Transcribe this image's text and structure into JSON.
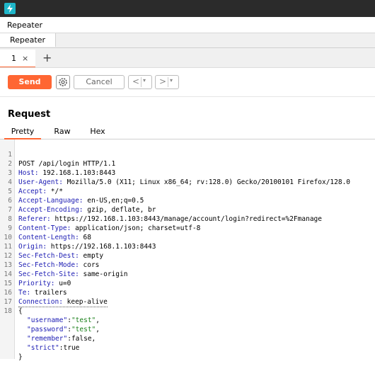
{
  "titlebar": {
    "logo_icon": "burp-logo-icon",
    "accent": "#1fb6c9"
  },
  "menubar": {
    "label": "Repeater"
  },
  "tool_tab": {
    "label": "Repeater"
  },
  "subtab": {
    "number": "1",
    "close_glyph": "×",
    "add_glyph": "+"
  },
  "toolbar": {
    "send_label": "Send",
    "cancel_label": "Cancel",
    "back_glyph": "<",
    "forward_glyph": ">",
    "dropdown_glyph": "▾",
    "send_color": "#ff6633"
  },
  "request": {
    "title": "Request",
    "views": [
      "Pretty",
      "Raw",
      "Hex"
    ],
    "active_view": "Pretty"
  },
  "lines": [
    {
      "n": "1",
      "name": "POST /api/login HTTP/1.1",
      "value": ""
    },
    {
      "n": "2",
      "name": "Host:",
      "value": " 192.168.1.103:8443"
    },
    {
      "n": "3",
      "name": "User-Agent:",
      "value": " Mozilla/5.0 (X11; Linux x86_64; rv:128.0) Gecko/20100101 Firefox/128.0"
    },
    {
      "n": "4",
      "name": "Accept:",
      "value": " */*"
    },
    {
      "n": "5",
      "name": "Accept-Language:",
      "value": " en-US,en;q=0.5"
    },
    {
      "n": "6",
      "name": "Accept-Encoding:",
      "value": " gzip, deflate, br"
    },
    {
      "n": "7",
      "name": "Referer:",
      "value": " https://192.168.1.103:8443/manage/account/login?redirect=%2Fmanage"
    },
    {
      "n": "8",
      "name": "Content-Type:",
      "value": " application/json; charset=utf-8"
    },
    {
      "n": "9",
      "name": "Content-Length:",
      "value": " 68"
    },
    {
      "n": "10",
      "name": "Origin:",
      "value": " https://192.168.1.103:8443"
    },
    {
      "n": "11",
      "name": "Sec-Fetch-Dest:",
      "value": " empty"
    },
    {
      "n": "12",
      "name": "Sec-Fetch-Mode:",
      "value": " cors"
    },
    {
      "n": "13",
      "name": "Sec-Fetch-Site:",
      "value": " same-origin"
    },
    {
      "n": "14",
      "name": "Priority:",
      "value": " u=0"
    },
    {
      "n": "15",
      "name": "Te:",
      "value": " trailers"
    },
    {
      "n": "16",
      "name": "Connection:",
      "value": " keep-alive"
    },
    {
      "n": "17",
      "name": "",
      "value": ""
    },
    {
      "n": "18",
      "name": "{",
      "value": ""
    }
  ],
  "json_body": [
    {
      "key": "\"username\"",
      "sep": ":",
      "val": "\"test\"",
      "end": ","
    },
    {
      "key": "\"password\"",
      "sep": ":",
      "val": "\"test\"",
      "end": ","
    },
    {
      "key": "\"remember\"",
      "sep": ":",
      "val": "false",
      "end": ","
    },
    {
      "key": "\"strict\"",
      "sep": ":",
      "val": "true",
      "end": ""
    }
  ],
  "json_close": "}"
}
